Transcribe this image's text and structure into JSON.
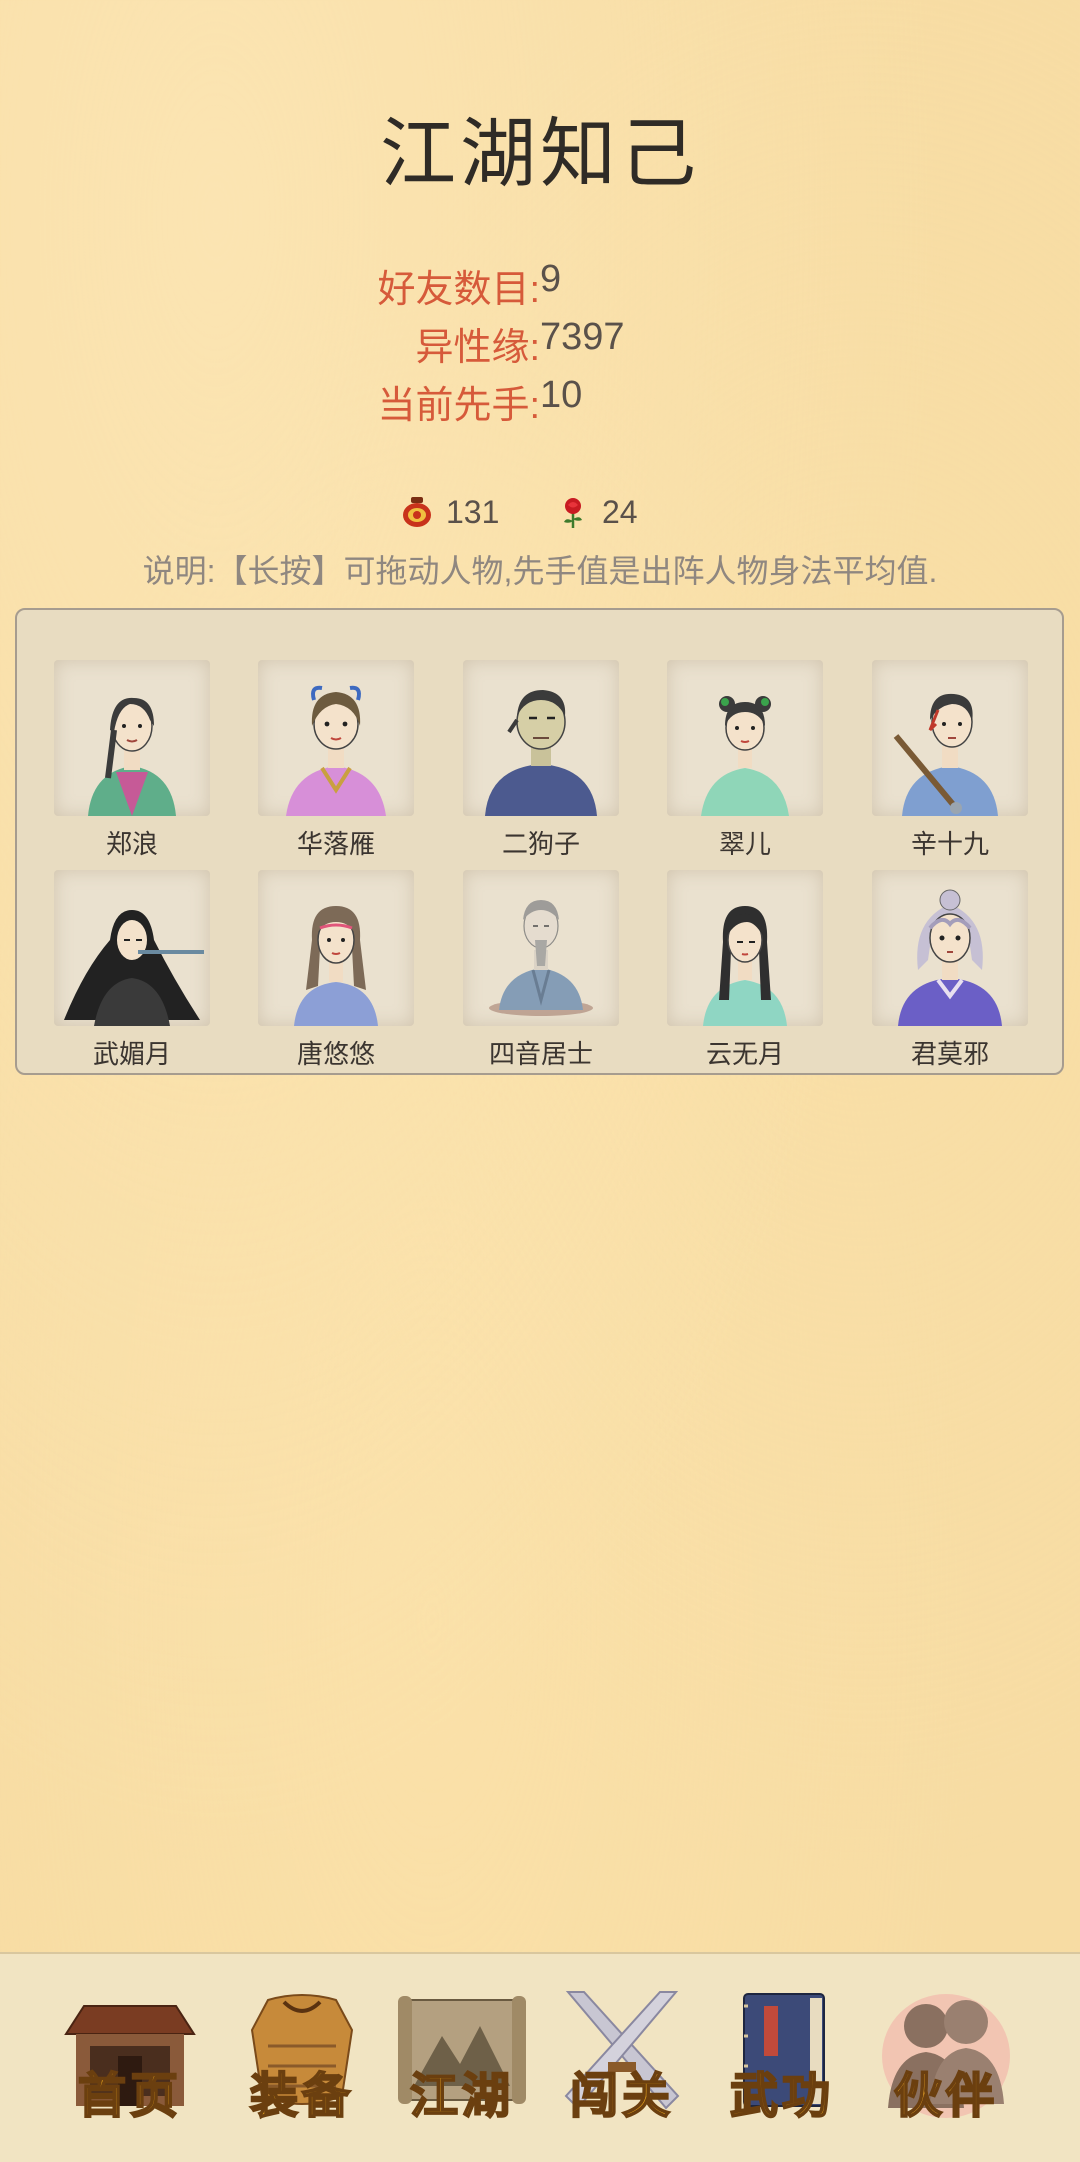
{
  "page": {
    "title": "江湖知己"
  },
  "stats": [
    {
      "label": "好友数目:",
      "value": "9"
    },
    {
      "label": "异性缘:",
      "value": "7397"
    },
    {
      "label": "当前先手:",
      "value": "10"
    }
  ],
  "resources": {
    "wine": {
      "icon": "wine-jar-icon",
      "value": "131"
    },
    "rose": {
      "icon": "rose-icon",
      "value": "24"
    }
  },
  "note": "说明:【长按】可拖动人物,先手值是出阵人物身法平均值.",
  "partners": [
    {
      "name": "郑浪",
      "robe": "#5fae8a"
    },
    {
      "name": "华落雁",
      "robe": "#d78fd8"
    },
    {
      "name": "二狗子",
      "robe": "#4c5a8f"
    },
    {
      "name": "翠儿",
      "robe": "#8fd6b8"
    },
    {
      "name": "辛十九",
      "robe": "#7f9fd0"
    },
    {
      "name": "武媚月",
      "robe": "#222222"
    },
    {
      "name": "唐悠悠",
      "robe": "#8c9fd6"
    },
    {
      "name": "四音居士",
      "robe": "#6d8db0"
    },
    {
      "name": "云无月",
      "robe": "#8fd6c3"
    },
    {
      "name": "君莫邪",
      "robe": "#6b5fc6"
    }
  ],
  "nav": [
    {
      "label": "首页",
      "icon": "house-icon",
      "active": false
    },
    {
      "label": "装备",
      "icon": "armor-icon",
      "active": false
    },
    {
      "label": "江湖",
      "icon": "map-scroll-icon",
      "active": false
    },
    {
      "label": "闯关",
      "icon": "crossed-swords-icon",
      "active": false
    },
    {
      "label": "武功",
      "icon": "book-icon",
      "active": false
    },
    {
      "label": "伙伴",
      "icon": "partners-icon",
      "active": true
    }
  ],
  "colors": {
    "background": "#f7dca3",
    "stat_label": "#d65a3a",
    "nav_label": "#e9a51f",
    "panel": "#e8dcc1"
  }
}
